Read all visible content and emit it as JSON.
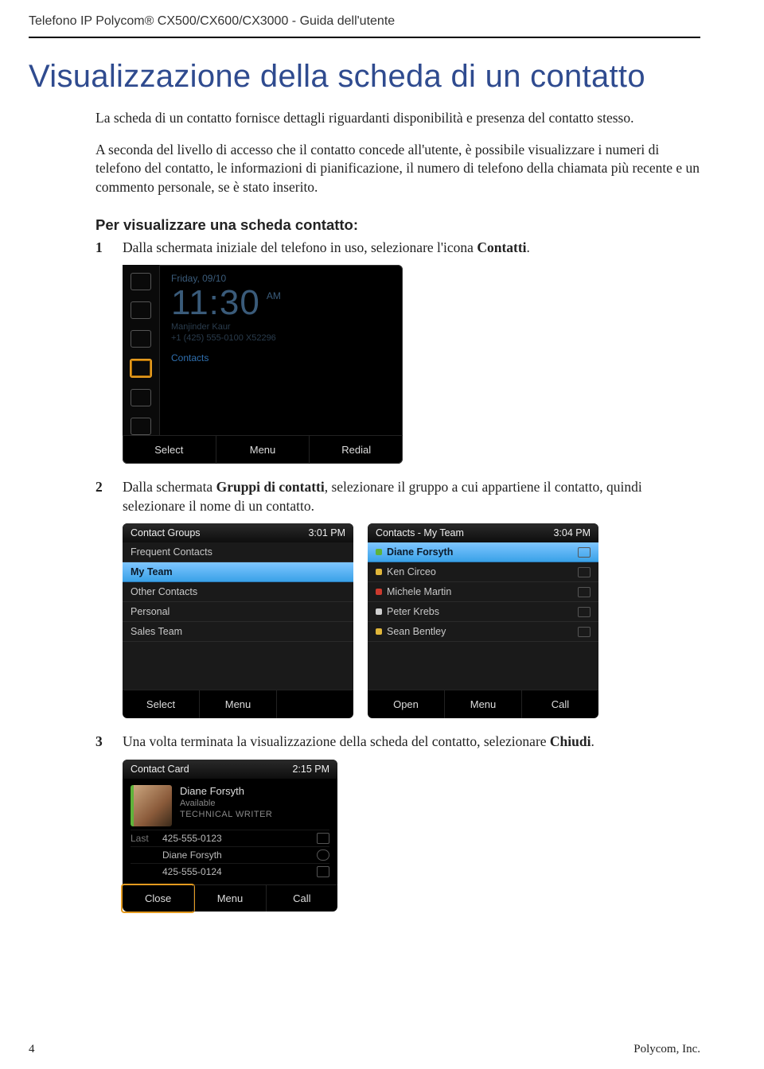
{
  "doc": {
    "running_head": "Telefono IP Polycom® CX500/CX600/CX3000 - Guida dell'utente",
    "title": "Visualizzazione della scheda di un contatto",
    "para1": "La scheda di un contatto fornisce dettagli riguardanti disponibilità e presenza del contatto stesso.",
    "para2": "A seconda del livello di accesso che il contatto concede all'utente, è possibile visualizzare i numeri di telefono del contatto, le informazioni di pianificazione, il numero di telefono della chiamata più recente e un commento personale, se è stato inserito.",
    "subhead": "Per visualizzare una scheda contatto:",
    "step1_pre": "Dalla schermata iniziale del telefono in uso, selezionare l'icona ",
    "step1_bold": "Contatti",
    "step1_post": ".",
    "step2_pre": "Dalla schermata ",
    "step2_bold": "Gruppi di contatti",
    "step2_post": ", selezionare il gruppo a cui appartiene il contatto, quindi selezionare il nome di un contatto.",
    "step3_pre": "Una volta terminata la visualizzazione della scheda del contatto, selezionare ",
    "step3_bold": "Chiudi",
    "step3_post": ".",
    "page_number": "4",
    "footer_right": "Polycom, Inc."
  },
  "home_screen": {
    "date": "Friday, 09/10",
    "time": "11:30",
    "ampm": "AM",
    "user_line1": "Manjinder Kaur",
    "user_line2": "+1 (425) 555-0100 X52296",
    "contacts_label": "Contacts",
    "soft": [
      "Select",
      "Menu",
      "Redial"
    ]
  },
  "groups_screen": {
    "title": "Contact Groups",
    "time": "3:01 PM",
    "items": [
      "Frequent Contacts",
      "My Team",
      "Other Contacts",
      "Personal",
      "Sales Team"
    ],
    "selected_index": 1,
    "soft": [
      "Select",
      "Menu",
      ""
    ]
  },
  "contacts_screen": {
    "title": "Contacts - My Team",
    "time": "3:04 PM",
    "items": [
      {
        "name": "Diane Forsyth",
        "status": "#5fb33a"
      },
      {
        "name": "Ken Circeo",
        "status": "#e0b63a"
      },
      {
        "name": "Michele Martin",
        "status": "#cc3a2e"
      },
      {
        "name": "Peter Krebs",
        "status": "#cfcfcf"
      },
      {
        "name": "Sean Bentley",
        "status": "#e0b63a"
      }
    ],
    "selected_index": 0,
    "soft": [
      "Open",
      "Menu",
      "Call"
    ]
  },
  "card_screen": {
    "title": "Contact Card",
    "time": "2:15 PM",
    "name": "Diane Forsyth",
    "availability": "Available",
    "role": "TECHNICAL WRITER",
    "rows": [
      {
        "label": "Last",
        "value": "425-555-0123"
      },
      {
        "label": "",
        "value": "Diane Forsyth"
      },
      {
        "label": "",
        "value": "425-555-0124"
      }
    ],
    "soft": [
      "Close",
      "Menu",
      "Call"
    ]
  }
}
